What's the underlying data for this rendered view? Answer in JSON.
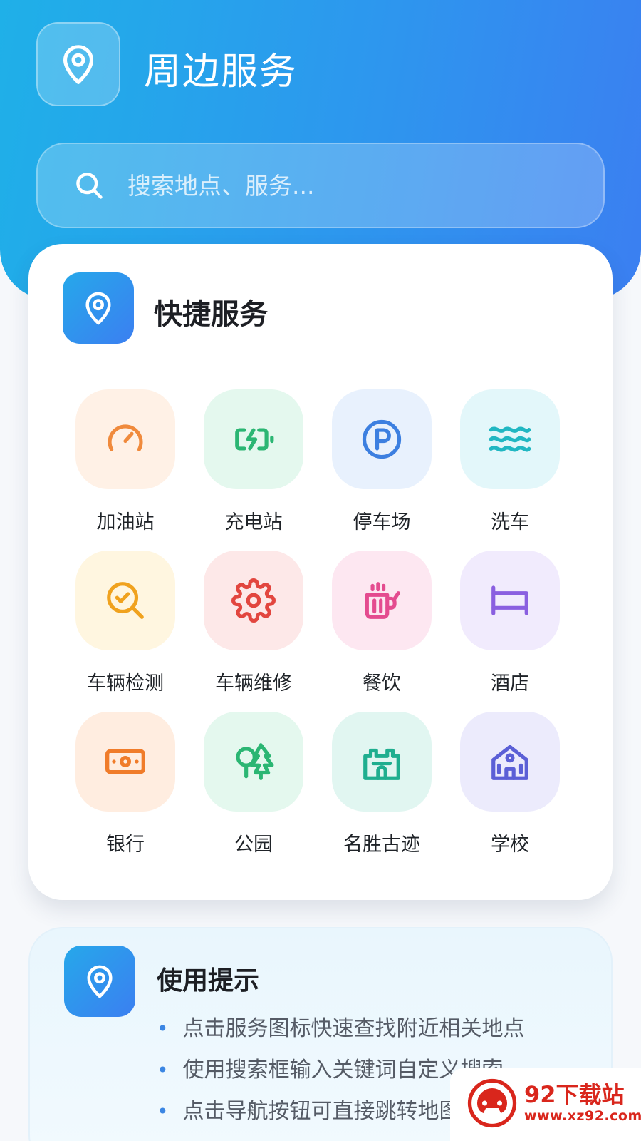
{
  "header": {
    "title": "周边服务",
    "icon": "location-pin-icon"
  },
  "search": {
    "placeholder": "搜索地点、服务...",
    "icon": "search-icon"
  },
  "quick_services": {
    "title": "快捷服务",
    "icon": "location-pin-icon",
    "items": [
      {
        "label": "加油站",
        "icon": "speedometer-icon",
        "color": "#f08a3c",
        "bg": "#fff1e6"
      },
      {
        "label": "充电站",
        "icon": "battery-charging-icon",
        "color": "#2bb673",
        "bg": "#e4f8ee"
      },
      {
        "label": "停车场",
        "icon": "parking-icon",
        "color": "#3c7fe0",
        "bg": "#e8f1fd"
      },
      {
        "label": "洗车",
        "icon": "waves-icon",
        "color": "#21b7c2",
        "bg": "#e3f7fa"
      },
      {
        "label": "车辆检测",
        "icon": "search-check-icon",
        "color": "#f0a21e",
        "bg": "#fff6e0"
      },
      {
        "label": "车辆维修",
        "icon": "gear-icon",
        "color": "#e2463f",
        "bg": "#fde8e8"
      },
      {
        "label": "餐饮",
        "icon": "beer-mug-icon",
        "color": "#e44b8f",
        "bg": "#fde7f1"
      },
      {
        "label": "酒店",
        "icon": "bed-icon",
        "color": "#8a5fe0",
        "bg": "#f1ebfd"
      },
      {
        "label": "银行",
        "icon": "banknote-icon",
        "color": "#f07c2a",
        "bg": "#ffede0"
      },
      {
        "label": "公园",
        "icon": "trees-icon",
        "color": "#2bb673",
        "bg": "#e4f8ee"
      },
      {
        "label": "名胜古迹",
        "icon": "castle-icon",
        "color": "#1fae8f",
        "bg": "#e1f6f1"
      },
      {
        "label": "学校",
        "icon": "school-icon",
        "color": "#5b5fd6",
        "bg": "#ecebfc"
      }
    ]
  },
  "tips": {
    "title": "使用提示",
    "icon": "location-pin-icon",
    "items": [
      "点击服务图标快速查找附近相关地点",
      "使用搜索框输入关键词自定义搜索",
      "点击导航按钮可直接跳转地图"
    ]
  },
  "watermark": {
    "title": "92下载站",
    "url": "www.xz92.com"
  }
}
